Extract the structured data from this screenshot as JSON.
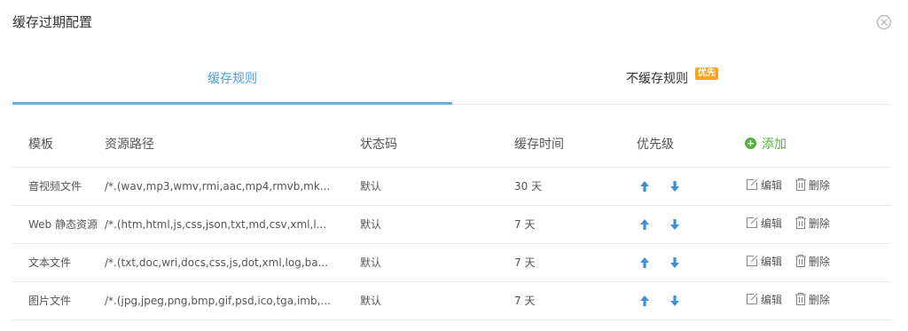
{
  "dialog": {
    "title": "缓存过期配置",
    "close_icon": "close-circle-icon"
  },
  "tabs": [
    {
      "label": "缓存规则",
      "active": true
    },
    {
      "label": "不缓存规则",
      "badge": "优先",
      "active": false
    }
  ],
  "table": {
    "headers": {
      "template": "模板",
      "path": "资源路径",
      "status": "状态码",
      "time": "缓存时间",
      "priority": "优先级",
      "add": "添加"
    },
    "rows": [
      {
        "template": "音视频文件",
        "path": "/*.(wav,mp3,wmv,rmi,aac,mp4,rmvb,mk...",
        "status": "默认",
        "time": "30 天"
      },
      {
        "template": "Web 静态资源",
        "path": "/*.(htm,html,js,css,json,txt,md,csv,xml,l...",
        "status": "默认",
        "time": "7 天"
      },
      {
        "template": "文本文件",
        "path": "/*.(txt,doc,wri,docs,css,js,dot,xml,log,ba...",
        "status": "默认",
        "time": "7 天"
      },
      {
        "template": "图片文件",
        "path": "/*.(jpg,jpeg,png,bmp,gif,psd,ico,tga,imb,...",
        "status": "默认",
        "time": "7 天"
      }
    ],
    "actions": {
      "edit": "编辑",
      "delete": "删除"
    }
  },
  "colors": {
    "accent_blue": "#4a9fe3",
    "add_green": "#52b43a",
    "badge_orange": "#f5a623"
  }
}
